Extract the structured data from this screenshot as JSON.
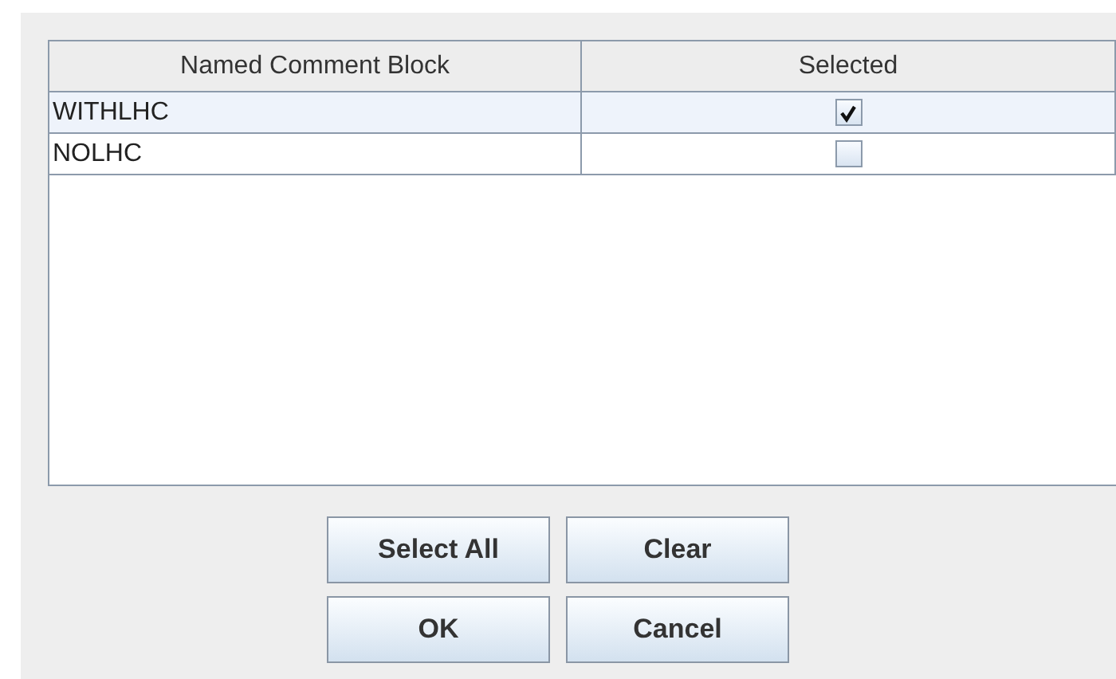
{
  "table": {
    "columns": [
      "Named Comment Block",
      "Selected"
    ],
    "rows": [
      {
        "name": "WITHLHC",
        "checked": true,
        "selected": true
      },
      {
        "name": "NOLHC",
        "checked": false,
        "selected": false
      }
    ]
  },
  "buttons": [
    [
      "Select All",
      "Clear"
    ],
    [
      "OK",
      "Cancel"
    ]
  ]
}
